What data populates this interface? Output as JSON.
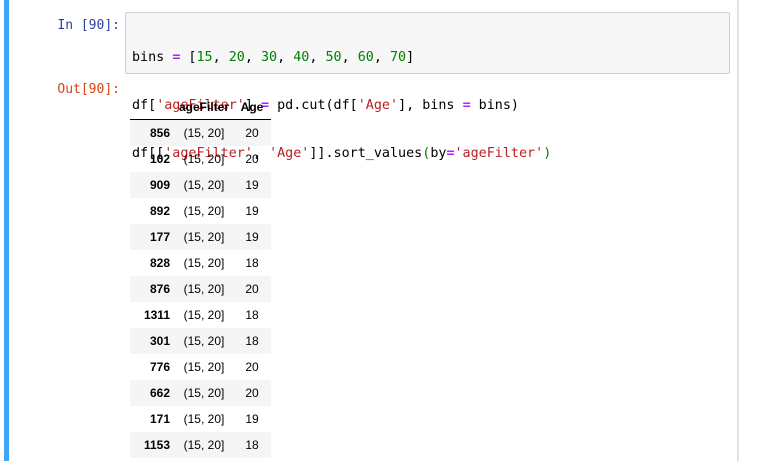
{
  "input_prompt": "In [90]:",
  "output_prompt": "Out[90]:",
  "code": {
    "l1": {
      "a": "bins ",
      "op": "=",
      "b": " [",
      "n1": "15",
      "c1": ", ",
      "n2": "20",
      "c2": ", ",
      "n3": "30",
      "c3": ", ",
      "n4": "40",
      "c4": ", ",
      "n5": "50",
      "c5": ", ",
      "n6": "60",
      "c6": ", ",
      "n7": "70",
      "end": "]"
    },
    "l2": {
      "a": "df[",
      "s1": "'ageFilter'",
      "b": "] ",
      "op": "=",
      "c": " pd.cut(df[",
      "s2": "'Age'",
      "d": "], bins ",
      "op2": "=",
      "e": " bins)"
    },
    "l3": {
      "a": "df[[",
      "s1": "'ageFilter'",
      "b": ", ",
      "s2": "'Age'",
      "c": "]].sort_values",
      "p1": "(",
      "d": "by",
      "op": "=",
      "s3": "'ageFilter'",
      "p2": ")"
    }
  },
  "table": {
    "columns": [
      "",
      "ageFilter",
      "Age"
    ],
    "rows": [
      {
        "index": "856",
        "ageFilter": "(15, 20]",
        "age": "20"
      },
      {
        "index": "102",
        "ageFilter": "(15, 20]",
        "age": "20"
      },
      {
        "index": "909",
        "ageFilter": "(15, 20]",
        "age": "19"
      },
      {
        "index": "892",
        "ageFilter": "(15, 20]",
        "age": "19"
      },
      {
        "index": "177",
        "ageFilter": "(15, 20]",
        "age": "19"
      },
      {
        "index": "828",
        "ageFilter": "(15, 20]",
        "age": "18"
      },
      {
        "index": "876",
        "ageFilter": "(15, 20]",
        "age": "20"
      },
      {
        "index": "1311",
        "ageFilter": "(15, 20]",
        "age": "18"
      },
      {
        "index": "301",
        "ageFilter": "(15, 20]",
        "age": "18"
      },
      {
        "index": "776",
        "ageFilter": "(15, 20]",
        "age": "20"
      },
      {
        "index": "662",
        "ageFilter": "(15, 20]",
        "age": "20"
      },
      {
        "index": "171",
        "ageFilter": "(15, 20]",
        "age": "19"
      },
      {
        "index": "1153",
        "ageFilter": "(15, 20]",
        "age": "18"
      }
    ]
  },
  "colors": {
    "selection_bar": "#42a5f5",
    "in_prompt": "#303f9f",
    "out_prompt": "#d84315",
    "string": "#ba2121",
    "number": "#008000",
    "operator": "#aa22ff"
  }
}
